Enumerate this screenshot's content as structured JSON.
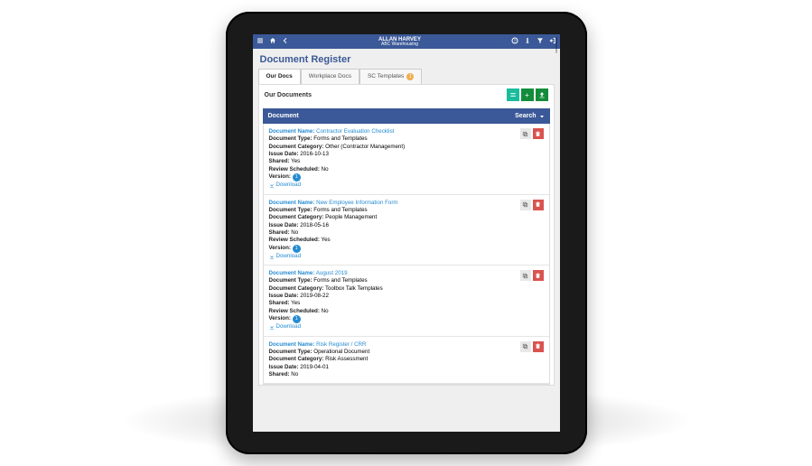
{
  "header": {
    "user": "ALLAN HARVEY",
    "org": "ABC Warehousing"
  },
  "page": {
    "title": "Document Register"
  },
  "tabs": [
    {
      "label": "Our Docs",
      "active": true
    },
    {
      "label": "Workplace Docs",
      "active": false
    },
    {
      "label": "SC Templates",
      "active": false,
      "badge": "1"
    }
  ],
  "panel": {
    "title": "Our Documents"
  },
  "list": {
    "header": "Document",
    "search": "Search"
  },
  "labels": {
    "doc_name": "Document Name:",
    "doc_type": "Document Type:",
    "doc_cat": "Document Category:",
    "issue": "Issue Date:",
    "shared": "Shared:",
    "review": "Review Scheduled:",
    "version": "Version:",
    "download": "Download"
  },
  "documents": [
    {
      "name": "Contractor Evaluation Checklist",
      "type": "Forms and Templates",
      "category": "Other (Contractor Management)",
      "issue": "2016-10-13",
      "shared": "Yes",
      "review": "No",
      "version": "1"
    },
    {
      "name": "New Employee Information Form",
      "type": "Forms and Templates",
      "category": "People Management",
      "issue": "2018-05-16",
      "shared": "No",
      "review": "Yes",
      "version": "1"
    },
    {
      "name": "August 2019",
      "type": "Forms and Templates",
      "category": "Toolbox Talk Templates",
      "issue": "2019-08-22",
      "shared": "Yes",
      "review": "No",
      "version": "1"
    },
    {
      "name": "Risk Register / CRR",
      "type": "Operational Document",
      "category": "Risk Assessment",
      "issue": "2019-04-01",
      "shared": "No",
      "review": "",
      "version": ""
    }
  ]
}
